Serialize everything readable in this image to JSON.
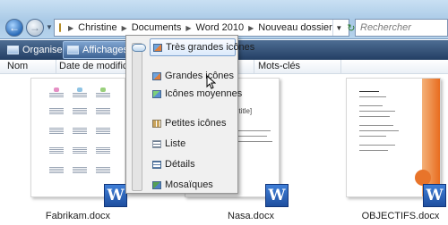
{
  "address_bar": {
    "crumbs": [
      "Christine",
      "Documents",
      "Word 2010",
      "Nouveau dossier"
    ]
  },
  "search": {
    "placeholder": "Rechercher"
  },
  "toolbar": {
    "organize_label": "Organiser",
    "views_label": "Affichages"
  },
  "columns": [
    "Nom",
    "Date de modificati",
    "Mots-clés"
  ],
  "files": [
    {
      "name": "Fabrikam.docx",
      "icon": "word-icon"
    },
    {
      "name": "Nasa.docx",
      "icon": "word-icon"
    },
    {
      "name": "OBJECTIFS.docx",
      "icon": "word-icon"
    }
  ],
  "nasa_doc": {
    "title_text": "t title]"
  },
  "views_menu": {
    "items": [
      {
        "label": "Très grandes icônes",
        "icon": "extra-large-icons-icon",
        "selected": true
      },
      {
        "label": "Grandes icônes",
        "icon": "large-icons-icon"
      },
      {
        "label": "Icônes moyennes",
        "icon": "medium-icons-icon"
      },
      {
        "label": "Petites icônes",
        "icon": "small-icons-icon"
      },
      {
        "label": "Liste",
        "icon": "list-icon"
      },
      {
        "label": "Détails",
        "icon": "details-icon"
      },
      {
        "label": "Mosaïques",
        "icon": "tiles-icon"
      }
    ]
  },
  "colors": {
    "nav_bar": "#b6d3ec",
    "toolbar": "#233f64",
    "accent_orange": "#e86c1e",
    "word_blue": "#1f4f9f"
  }
}
